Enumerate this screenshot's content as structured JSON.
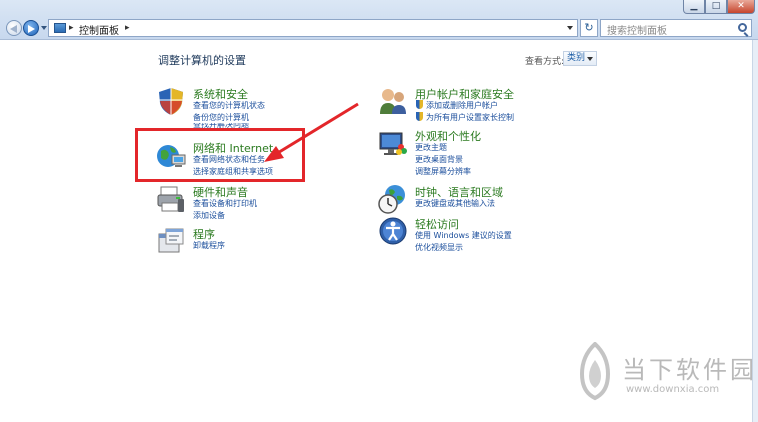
{
  "address": {
    "crumb": "控制面板",
    "search_placeholder": "搜索控制面板",
    "refresh_glyph": "↻"
  },
  "window": {
    "min": "▁",
    "max": "□",
    "close": "✕"
  },
  "header": {
    "title": "调整计算机的设置",
    "view_label": "查看方式:",
    "view_value": "类别"
  },
  "categories": {
    "security": {
      "title": "系统和安全",
      "links": [
        "查看您的计算机状态",
        "备份您的计算机",
        "查找并解决问题"
      ]
    },
    "network": {
      "title": "网络和 Internet",
      "links": [
        "查看网络状态和任务",
        "选择家庭组和共享选项"
      ]
    },
    "hardware": {
      "title": "硬件和声音",
      "links": [
        "查看设备和打印机",
        "添加设备"
      ]
    },
    "programs": {
      "title": "程序",
      "links": [
        "卸载程序"
      ]
    },
    "users": {
      "title": "用户帐户和家庭安全",
      "links": [
        "添加或删除用户帐户",
        "为所有用户设置家长控制"
      ]
    },
    "appearance": {
      "title": "外观和个性化",
      "links": [
        "更改主题",
        "更改桌面背景",
        "调整屏幕分辨率"
      ]
    },
    "clock": {
      "title": "时钟、语言和区域",
      "links": [
        "更改键盘或其他输入法"
      ]
    },
    "ease": {
      "title": "轻松访问",
      "links": [
        "使用 Windows 建议的设置",
        "优化视频显示"
      ]
    }
  },
  "watermark": {
    "text": "当下软件园",
    "url": "www.downxia.com"
  },
  "colors": {
    "highlight": "#e3262a",
    "link": "#1c4f9c",
    "category_title": "#2a7a1f"
  }
}
